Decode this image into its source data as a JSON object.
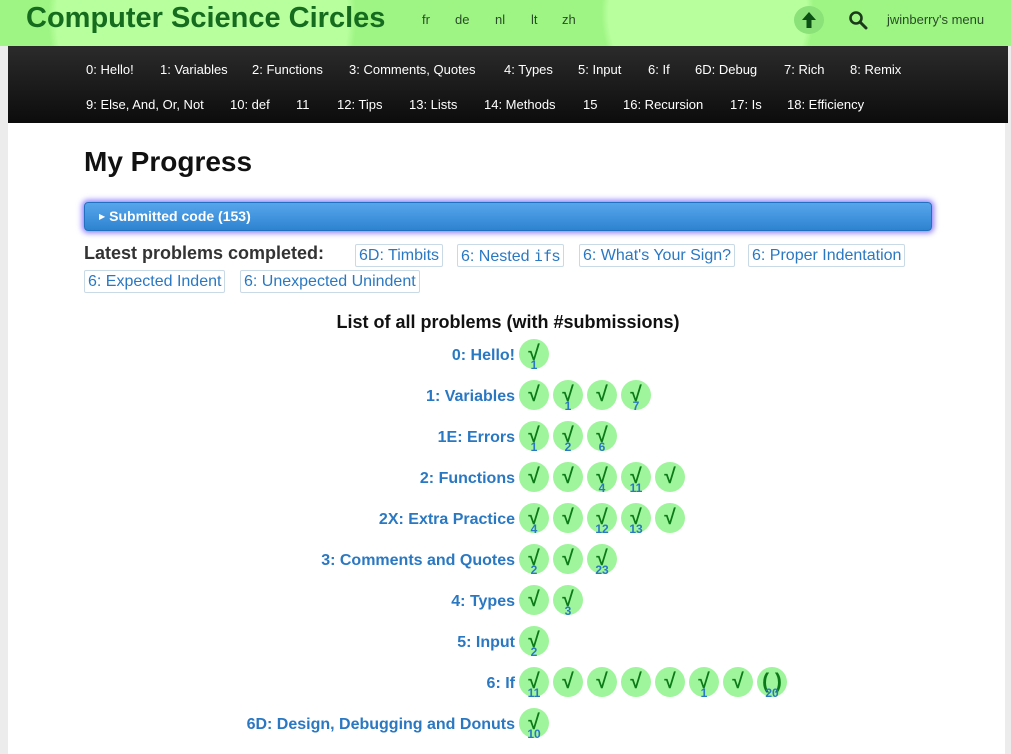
{
  "header": {
    "brand": "Computer Science Circles",
    "languages": [
      "fr",
      "de",
      "nl",
      "lt",
      "zh"
    ],
    "user_menu": "jwinberry's menu"
  },
  "nav": {
    "row1": [
      "0: Hello!",
      "1: Variables",
      "2: Functions",
      "3: Comments, Quotes",
      "4: Types",
      "5: Input",
      "6: If",
      "6D: Debug",
      "7: Rich",
      "8: Remix"
    ],
    "row2": [
      "9: Else, And, Or, Not",
      "10: def",
      "11",
      "12: Tips",
      "13: Lists",
      "14: Methods",
      "15",
      "16: Recursion",
      "17: Is",
      "18: Efficiency"
    ]
  },
  "main": {
    "title": "My Progress",
    "submitted_code": "Submitted code (153)",
    "latest_label": "Latest problems completed:",
    "latest_chips": [
      {
        "pre": "6D: Timbits",
        "mono": "",
        "post": ""
      },
      {
        "pre": "6: Nested ",
        "mono": "if",
        "post": "s"
      },
      {
        "pre": "6: What's Your Sign?",
        "mono": "",
        "post": ""
      },
      {
        "pre": "6: Proper Indentation",
        "mono": "",
        "post": ""
      },
      {
        "pre": "6: Expected Indent",
        "mono": "",
        "post": ""
      },
      {
        "pre": "6: Unexpected Unindent",
        "mono": "",
        "post": ""
      }
    ],
    "list_title": "List of all problems (with #submissions)"
  },
  "problems": [
    {
      "label": "0: Hello!",
      "items": [
        {
          "mark": "√",
          "count": "1"
        }
      ]
    },
    {
      "label": "1: Variables",
      "items": [
        {
          "mark": "√",
          "count": ""
        },
        {
          "mark": "√",
          "count": "1"
        },
        {
          "mark": "√",
          "count": ""
        },
        {
          "mark": "√",
          "count": "7"
        }
      ]
    },
    {
      "label": "1E: Errors",
      "items": [
        {
          "mark": "√",
          "count": "1"
        },
        {
          "mark": "√",
          "count": "2"
        },
        {
          "mark": "√",
          "count": "6"
        }
      ]
    },
    {
      "label": "2: Functions",
      "items": [
        {
          "mark": "√",
          "count": ""
        },
        {
          "mark": "√",
          "count": ""
        },
        {
          "mark": "√",
          "count": "4"
        },
        {
          "mark": "√",
          "count": "11"
        },
        {
          "mark": "√",
          "count": ""
        }
      ]
    },
    {
      "label": "2X: Extra Practice",
      "items": [
        {
          "mark": "√",
          "count": "4"
        },
        {
          "mark": "√",
          "count": ""
        },
        {
          "mark": "√",
          "count": "12"
        },
        {
          "mark": "√",
          "count": "13"
        },
        {
          "mark": "√",
          "count": ""
        }
      ]
    },
    {
      "label": "3: Comments and Quotes",
      "items": [
        {
          "mark": "√",
          "count": "2"
        },
        {
          "mark": "√",
          "count": ""
        },
        {
          "mark": "√",
          "count": "23"
        }
      ]
    },
    {
      "label": "4: Types",
      "items": [
        {
          "mark": "√",
          "count": ""
        },
        {
          "mark": "√",
          "count": "3"
        }
      ]
    },
    {
      "label": "5: Input",
      "items": [
        {
          "mark": "√",
          "count": "2"
        }
      ]
    },
    {
      "label": "6: If",
      "items": [
        {
          "mark": "√",
          "count": "11"
        },
        {
          "mark": "√",
          "count": ""
        },
        {
          "mark": "√",
          "count": ""
        },
        {
          "mark": "√",
          "count": ""
        },
        {
          "mark": "√",
          "count": ""
        },
        {
          "mark": "√",
          "count": "1"
        },
        {
          "mark": "√",
          "count": ""
        },
        {
          "mark": "( )",
          "count": "20"
        }
      ]
    },
    {
      "label": "6D: Design, Debugging and Donuts",
      "items": [
        {
          "mark": "√",
          "count": "10"
        }
      ]
    }
  ]
}
